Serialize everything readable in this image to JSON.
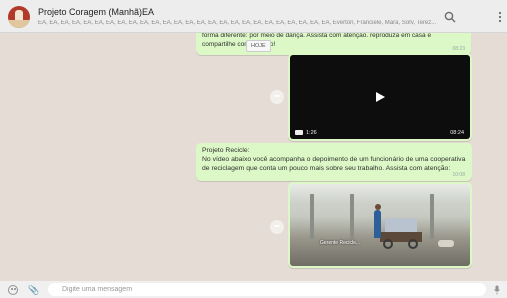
{
  "header": {
    "title": "Projeto Coragem (Manhã)EA",
    "members": "EA, EA, EA, EA, EA, EA, EA, EA, EA, EA, EA, EA, EA, EA, EA, EA, EA, EA, EA, EA, EA, EA, EA, EA, EA, EA, Everton, Franciele, Mara, Sofv, Terez..."
  },
  "messages": [
    {
      "text": "forma diferente: por meio de dança. Assista com atenção. reproduza em casa e compartilhe com o grupo!",
      "time": "08:23",
      "tooltip": "HOJE"
    },
    {
      "video_duration": "1:26",
      "time": "08:24"
    },
    {
      "text": "Projeto Recicle:\nNo vídeo abaixo você acompanha o depoimento de um funcionário de uma cooperativa de reciclagem que conta um pouco mais sobre seu trabalho. Assista com atenção:",
      "time": "10:08"
    },
    {
      "caption": "Gerente Recicle..."
    }
  ],
  "composer": {
    "placeholder": "Digite uma mensagem"
  },
  "icons": {
    "search": "search-icon",
    "menu": "kebab-menu-icon",
    "emoji": "emoji-icon",
    "attach": "paperclip-icon",
    "mic": "microphone-icon",
    "play": "play-icon",
    "forward": "forward-icon"
  },
  "colors": {
    "outgoing_bubble": "#dcf8c6",
    "chat_background": "#e5ddd5",
    "header": "#ededed"
  }
}
